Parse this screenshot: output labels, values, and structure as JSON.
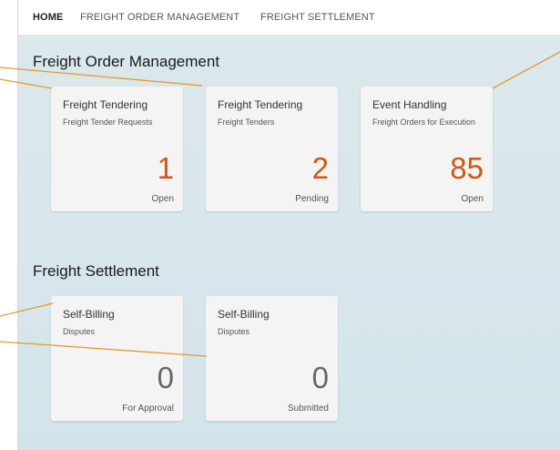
{
  "nav": {
    "items": [
      {
        "label": "HOME",
        "active": true
      },
      {
        "label": "FREIGHT ORDER MANAGEMENT",
        "active": false
      },
      {
        "label": "FREIGHT SETTLEMENT",
        "active": false
      }
    ]
  },
  "sections": [
    {
      "title": "Freight Order Management",
      "tiles": [
        {
          "title": "Freight Tendering",
          "subtitle": "Freight Tender Requests",
          "number": "1",
          "unit": "Open",
          "number_color": "#d25510"
        },
        {
          "title": "Freight Tendering",
          "subtitle": "Freight Tenders",
          "number": "2",
          "unit": "Pending",
          "number_color": "#d25510"
        },
        {
          "title": "Event Handling",
          "subtitle": "Freight Orders for Execution",
          "number": "85",
          "unit": "Open",
          "number_color": "#d25510"
        }
      ]
    },
    {
      "title": "Freight Settlement",
      "tiles": [
        {
          "title": "Self-Billing",
          "subtitle": "Disputes",
          "number": "0",
          "unit": "For Approval",
          "number_color": "#666666"
        },
        {
          "title": "Self-Billing",
          "subtitle": "Disputes",
          "number": "0",
          "unit": "Submitted",
          "number_color": "#666666"
        }
      ]
    }
  ],
  "colors": {
    "callout_line": "#e59a2a",
    "accent_number": "#d25510",
    "background": "#d8e7ec"
  }
}
